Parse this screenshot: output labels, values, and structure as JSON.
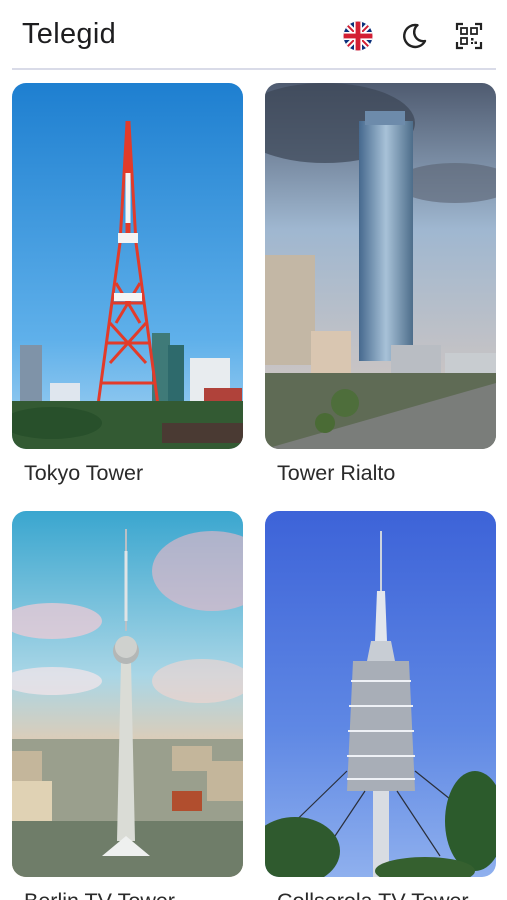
{
  "app": {
    "title": "Telegid",
    "accent_divider": "#d9dbe8"
  },
  "toolbar": {
    "language_icon": "uk-flag-icon",
    "theme_icon": "moon-icon",
    "qr_icon": "qr-code-icon"
  },
  "towers": [
    {
      "name": "Tokyo Tower"
    },
    {
      "name": "Tower Rialto"
    },
    {
      "name": "Berlin TV Tower"
    },
    {
      "name": "Collserola TV Tower"
    }
  ]
}
